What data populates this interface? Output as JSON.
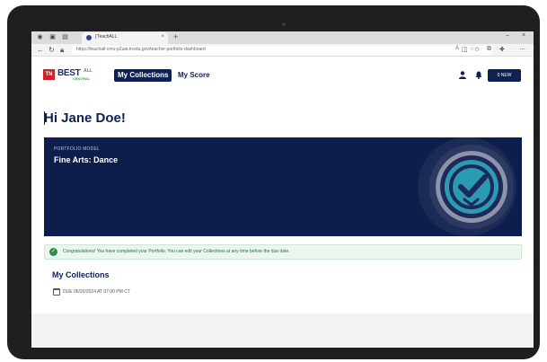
{
  "browser": {
    "tab_title": "j'TeachALL",
    "tab_close": "×",
    "new_tab": "+",
    "url": "https://teachall-cmu-p2uat.tnedu.gov/teacher-portfolio-dashboard",
    "win_minimize": "–",
    "win_close": "×"
  },
  "logo": {
    "tn": "TN",
    "best": "BEST",
    "all": "ALL",
    "central": "CENTRAL"
  },
  "nav": {
    "my_collections": "My Collections",
    "my_score": "My Score"
  },
  "header": {
    "new_button": "0 NEW"
  },
  "greeting": "Hi Jane Doe!",
  "banner": {
    "label": "PORTFOLIO MODEL",
    "title": "Fine Arts: Dance"
  },
  "alert": {
    "text": "Congratulations! You have completed your Portfolio. You can edit your Collections at any time before the due date."
  },
  "collections": {
    "title": "My Collections",
    "due": "DUE 06/20/2024 AT 07:00 PM CT"
  },
  "colors": {
    "navy": "#0d1e4c",
    "teal": "#2b9bb3",
    "success": "#2e8b4a"
  }
}
